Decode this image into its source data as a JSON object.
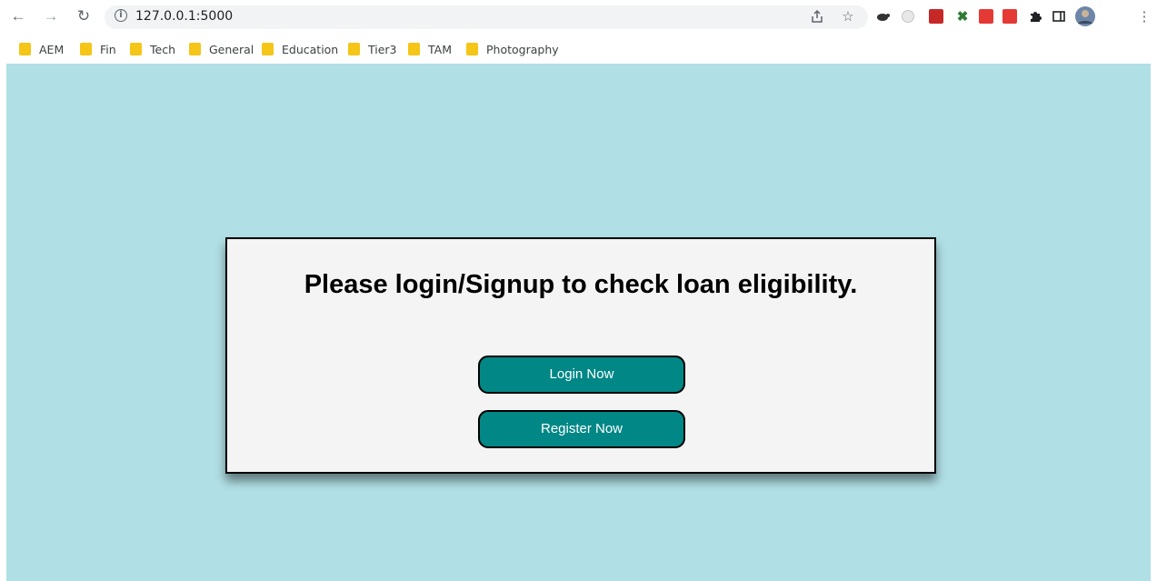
{
  "browser": {
    "url": "127.0.0.1:5000",
    "icons": {
      "back": "arrow-left-icon",
      "forward": "arrow-right-icon",
      "reload": "reload-icon",
      "info": "info-icon",
      "share": "share-icon",
      "bookmark": "star-icon",
      "extensions": "puzzle-icon",
      "side_panel": "side-panel-icon",
      "profile": "avatar",
      "menu": "kebab-menu-icon"
    },
    "bookmarks": [
      "AEM",
      "Fin",
      "Tech",
      "General",
      "Education",
      "Tier3",
      "TAM",
      "Photography"
    ]
  },
  "page": {
    "background_color": "#b0dfe5",
    "card_background": "#f4f4f4",
    "button_color": "#018786",
    "title": "Please login/Signup to check loan eligibility.",
    "login_label": "Login Now",
    "register_label": "Register Now"
  }
}
